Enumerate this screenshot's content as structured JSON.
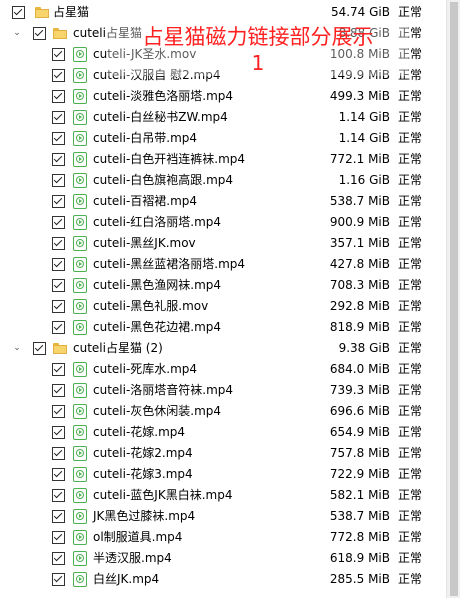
{
  "overlay": {
    "line1": "占星猫磁力链接部分展示",
    "line2": "1"
  },
  "root": {
    "name": "占星猫",
    "size": "54.74 GiB",
    "status": "正常"
  },
  "folders": [
    {
      "name": "cuteli占星猫",
      "size": "8.88 GiB",
      "status": "正常",
      "files": [
        {
          "name": "cuteli-JK圣水.mov",
          "size": "100.8 MiB",
          "status": "正常"
        },
        {
          "name": "cuteli-汉服自 慰2.mp4",
          "size": "149.9 MiB",
          "status": "正常"
        },
        {
          "name": "cuteli-淡雅色洛丽塔.mp4",
          "size": "499.3 MiB",
          "status": "正常"
        },
        {
          "name": "cuteli-白丝秘书ZW.mp4",
          "size": "1.14 GiB",
          "status": "正常"
        },
        {
          "name": "cuteli-白吊带.mp4",
          "size": "1.14 GiB",
          "status": "正常"
        },
        {
          "name": "cuteli-白色开裆连裤袜.mp4",
          "size": "772.1 MiB",
          "status": "正常"
        },
        {
          "name": "cuteli-白色旗袍高跟.mp4",
          "size": "1.16 GiB",
          "status": "正常"
        },
        {
          "name": "cuteli-百褶裙.mp4",
          "size": "538.7 MiB",
          "status": "正常"
        },
        {
          "name": "cuteli-红白洛丽塔.mp4",
          "size": "900.9 MiB",
          "status": "正常"
        },
        {
          "name": "cuteli-黑丝JK.mov",
          "size": "357.1 MiB",
          "status": "正常"
        },
        {
          "name": "cuteli-黑丝蓝裙洛丽塔.mp4",
          "size": "427.8 MiB",
          "status": "正常"
        },
        {
          "name": "cuteli-黑色渔网袜.mp4",
          "size": "708.3 MiB",
          "status": "正常"
        },
        {
          "name": "cuteli-黑色礼服.mov",
          "size": "292.8 MiB",
          "status": "正常"
        },
        {
          "name": "cuteli-黑色花边裙.mp4",
          "size": "818.9 MiB",
          "status": "正常"
        }
      ]
    },
    {
      "name": "cuteli占星猫 (2)",
      "size": "9.38 GiB",
      "status": "正常",
      "files": [
        {
          "name": "cuteli-死库水.mp4",
          "size": "684.0 MiB",
          "status": "正常"
        },
        {
          "name": "cuteli-洛丽塔音符袜.mp4",
          "size": "739.3 MiB",
          "status": "正常"
        },
        {
          "name": "cuteli-灰色休闲装.mp4",
          "size": "696.6 MiB",
          "status": "正常"
        },
        {
          "name": "cuteli-花嫁.mp4",
          "size": "654.9 MiB",
          "status": "正常"
        },
        {
          "name": "cuteli-花嫁2.mp4",
          "size": "757.8 MiB",
          "status": "正常"
        },
        {
          "name": "cuteli-花嫁3.mp4",
          "size": "722.9 MiB",
          "status": "正常"
        },
        {
          "name": "cuteli-蓝色JK黑白袜.mp4",
          "size": "582.1 MiB",
          "status": "正常"
        },
        {
          "name": "JK黑色过膝袜.mp4",
          "size": "538.7 MiB",
          "status": "正常"
        },
        {
          "name": "ol制服道具.mp4",
          "size": "772.8 MiB",
          "status": "正常"
        },
        {
          "name": "半透汉服.mp4",
          "size": "618.9 MiB",
          "status": "正常"
        },
        {
          "name": "白丝JK.mp4",
          "size": "285.5 MiB",
          "status": "正常"
        }
      ]
    }
  ]
}
